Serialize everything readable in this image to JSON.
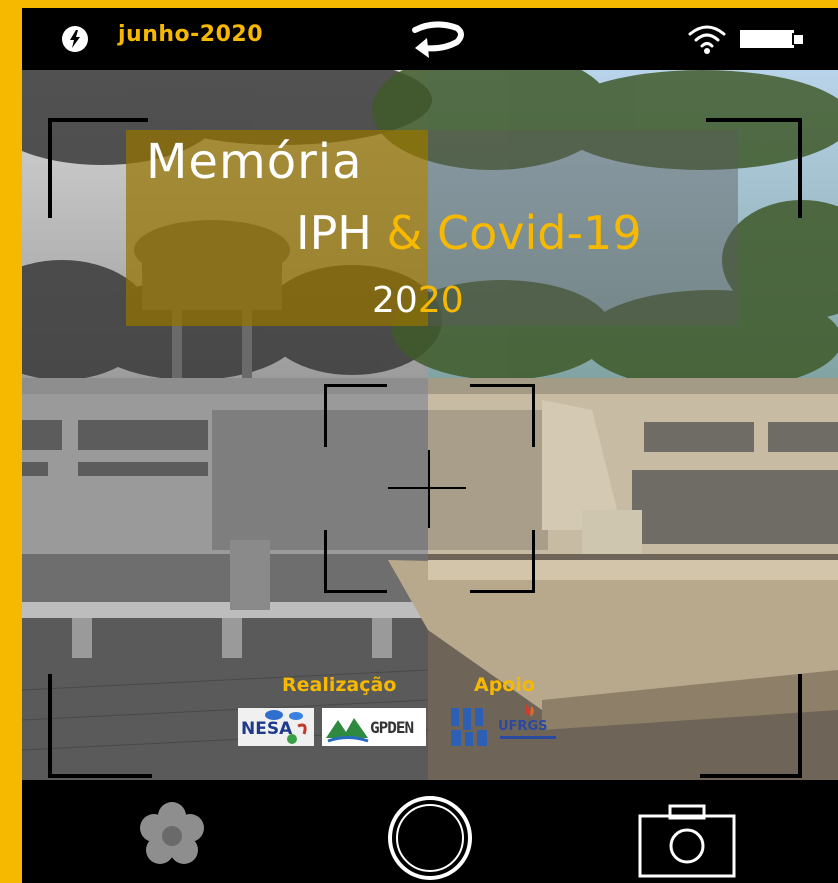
{
  "status_bar": {
    "date": "junho-2020",
    "icons": [
      "flash-icon",
      "rotate-icon",
      "wifi-icon",
      "battery-icon"
    ]
  },
  "title": {
    "line1": "Memória",
    "line2_a": "IPH",
    "line2_b": "& Covid-19",
    "year_a": "20",
    "year_b": "20"
  },
  "sponsors": {
    "realizacao_label": "Realização",
    "apoio_label": "Apoio",
    "nesa_text": "NESA",
    "gpden_text": "GPDEN",
    "ufrgs_text": "UFRGS"
  },
  "bottom_bar": {
    "icons": [
      "gallery-icon",
      "shutter-button",
      "camera-icon"
    ]
  },
  "colors": {
    "accent": "#f7b900",
    "frame": "#f7b900",
    "bars": "#000000"
  }
}
